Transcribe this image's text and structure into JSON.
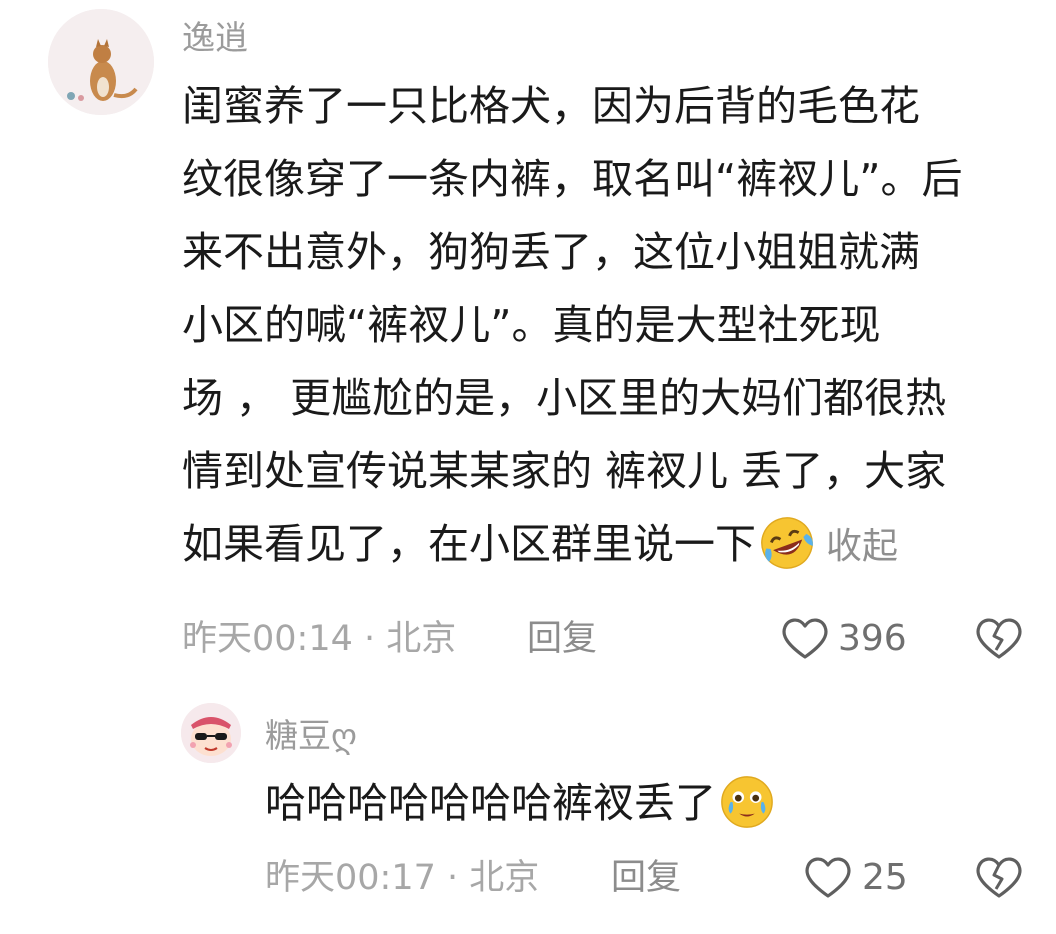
{
  "comments": [
    {
      "username": "逸逍",
      "avatar_icon": "cat-avatar",
      "text_lines": [
        "闺蜜养了一只比格犬，因为后背的毛色花",
        "纹很像穿了一条内裤，取名叫“裤衩儿”。后",
        "来不出意外，狗狗丢了，这位小姐姐就满",
        "小区的喊“裤衩儿”。真的是大型社死现",
        "场 ， 更尴尬的是，小区里的大妈们都很热",
        "情到处宣传说某某家的 裤衩儿 丢了，大家",
        "如果看见了，在小区群里说一下"
      ],
      "emoji": "rolling-laughing-emoji",
      "collapse": "收起",
      "time_location": "昨天00:14 · 北京",
      "reply": "回复",
      "likes": "396"
    },
    {
      "username": "糖豆ღ",
      "avatar_icon": "cartoon-avatar",
      "text": "哈哈哈哈哈哈哈裤衩丢了",
      "emoji": "tears-of-joy-emoji",
      "time_location": "昨天00:17 · 北京",
      "reply": "回复",
      "likes": "25"
    }
  ],
  "colors": {
    "username": "#9b9b9b",
    "meta": "#a7a7a7",
    "text": "#1a1a1a",
    "emoji_yellow": "#f7c531"
  }
}
